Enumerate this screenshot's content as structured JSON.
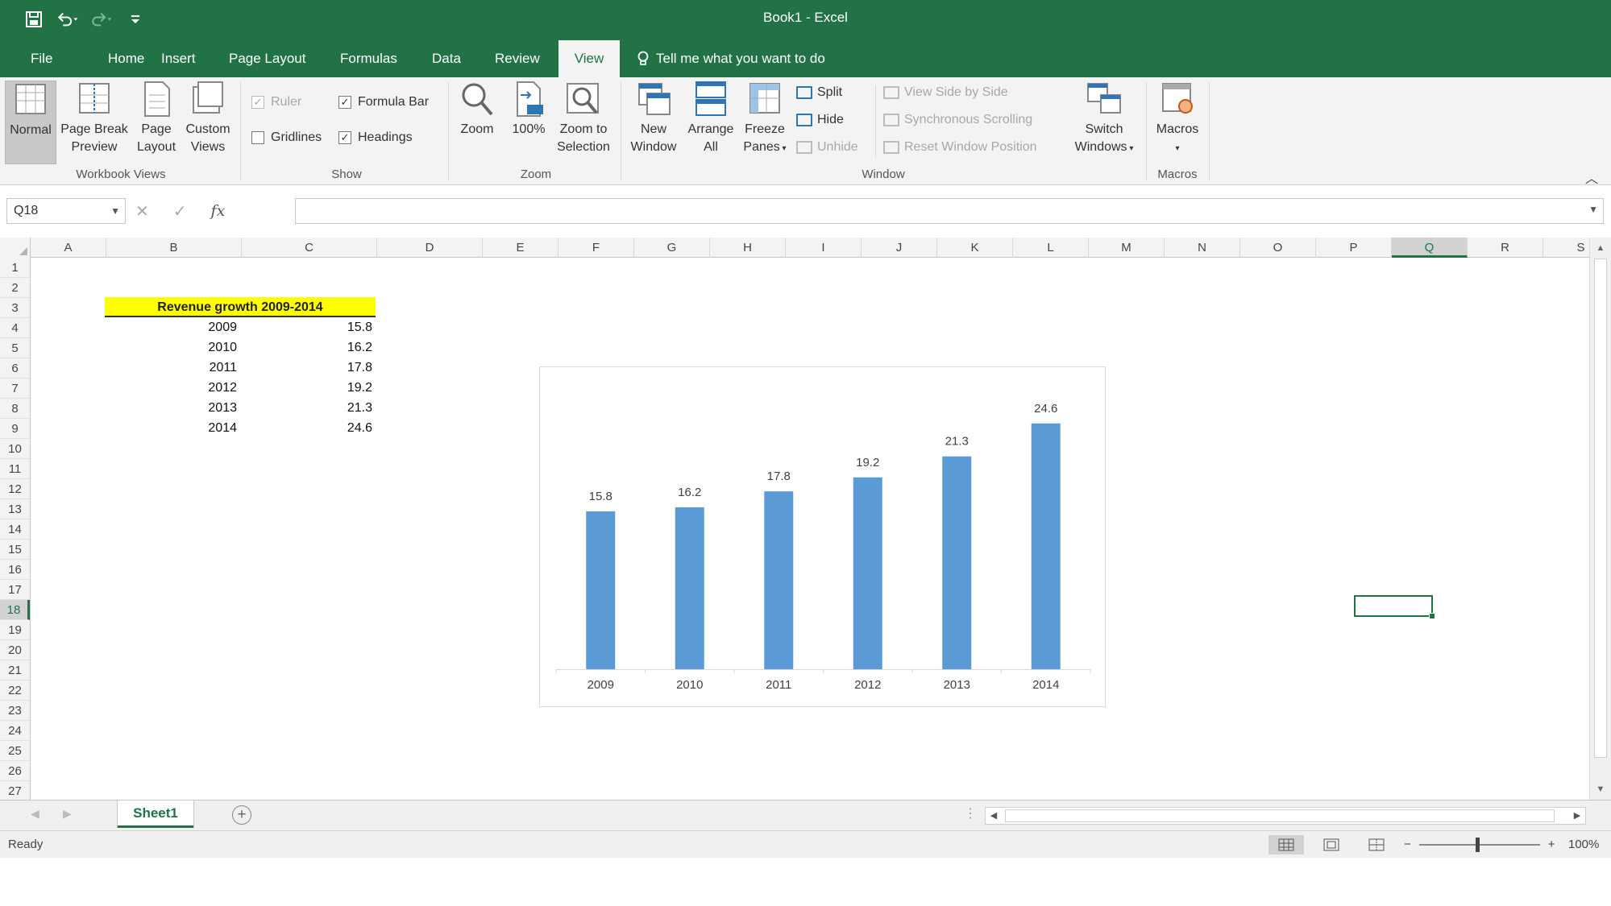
{
  "window": {
    "title": "Book1 - Excel"
  },
  "qat": {
    "save_icon": "save-icon",
    "undo_icon": "undo-icon",
    "redo_icon": "redo-icon",
    "customize_icon": "customize-qat-icon"
  },
  "tabs": [
    "File",
    "Home",
    "Insert",
    "Page Layout",
    "Formulas",
    "Data",
    "Review",
    "View"
  ],
  "active_tab": "View",
  "tell_me": "Tell me what you want to do",
  "ribbon": {
    "workbook_views": {
      "label": "Workbook Views",
      "normal": "Normal",
      "page_break_1": "Page Break",
      "page_break_2": "Preview",
      "page_layout_1": "Page",
      "page_layout_2": "Layout",
      "custom_1": "Custom",
      "custom_2": "Views"
    },
    "show": {
      "label": "Show",
      "ruler": "Ruler",
      "formula_bar": "Formula Bar",
      "gridlines": "Gridlines",
      "headings": "Headings"
    },
    "zoom": {
      "label": "Zoom",
      "zoom": "Zoom",
      "hundred": "100%",
      "zoom_sel_1": "Zoom to",
      "zoom_sel_2": "Selection"
    },
    "window": {
      "label": "Window",
      "new_1": "New",
      "new_2": "Window",
      "arrange_1": "Arrange",
      "arrange_2": "All",
      "freeze_1": "Freeze",
      "freeze_2": "Panes",
      "split": "Split",
      "hide": "Hide",
      "unhide": "Unhide",
      "side_by_side": "View Side by Side",
      "sync_scroll": "Synchronous Scrolling",
      "reset_pos": "Reset Window Position",
      "switch_1": "Switch",
      "switch_2": "Windows"
    },
    "macros": {
      "label": "Macros",
      "macros": "Macros"
    }
  },
  "formula_bar": {
    "name_box": "Q18",
    "content": ""
  },
  "columns": [
    "A",
    "B",
    "C",
    "D",
    "E",
    "F",
    "G",
    "H",
    "I",
    "J",
    "K",
    "L",
    "M",
    "N",
    "O",
    "P",
    "Q",
    "R",
    "S"
  ],
  "rows": [
    "1",
    "2",
    "3",
    "4",
    "5",
    "6",
    "7",
    "8",
    "9",
    "10",
    "11",
    "12",
    "13",
    "14",
    "15",
    "16",
    "17",
    "18",
    "19",
    "20",
    "21",
    "22",
    "23",
    "24",
    "25",
    "26",
    "27"
  ],
  "selected": {
    "column": "Q",
    "row": "18"
  },
  "sheet": {
    "header": "Revenue growth 2009-2014",
    "table": [
      {
        "year": "2009",
        "value": "15.8"
      },
      {
        "year": "2010",
        "value": "16.2"
      },
      {
        "year": "2011",
        "value": "17.8"
      },
      {
        "year": "2012",
        "value": "19.2"
      },
      {
        "year": "2013",
        "value": "21.3"
      },
      {
        "year": "2014",
        "value": "24.6"
      }
    ]
  },
  "chart_data": {
    "type": "bar",
    "categories": [
      "2009",
      "2010",
      "2011",
      "2012",
      "2013",
      "2014"
    ],
    "values": [
      15.8,
      16.2,
      17.8,
      19.2,
      21.3,
      24.6
    ],
    "title": "",
    "xlabel": "",
    "ylabel": "",
    "ylim": [
      0,
      27
    ],
    "grid": false,
    "data_labels": true,
    "bar_color": "#5b9bd5"
  },
  "sheet_tabs": [
    "Sheet1"
  ],
  "status": {
    "ready": "Ready",
    "zoom": "100%"
  },
  "colors": {
    "excel_green": "#217346",
    "highlight_yellow": "#ffff00",
    "bar_blue": "#5b9bd5"
  }
}
